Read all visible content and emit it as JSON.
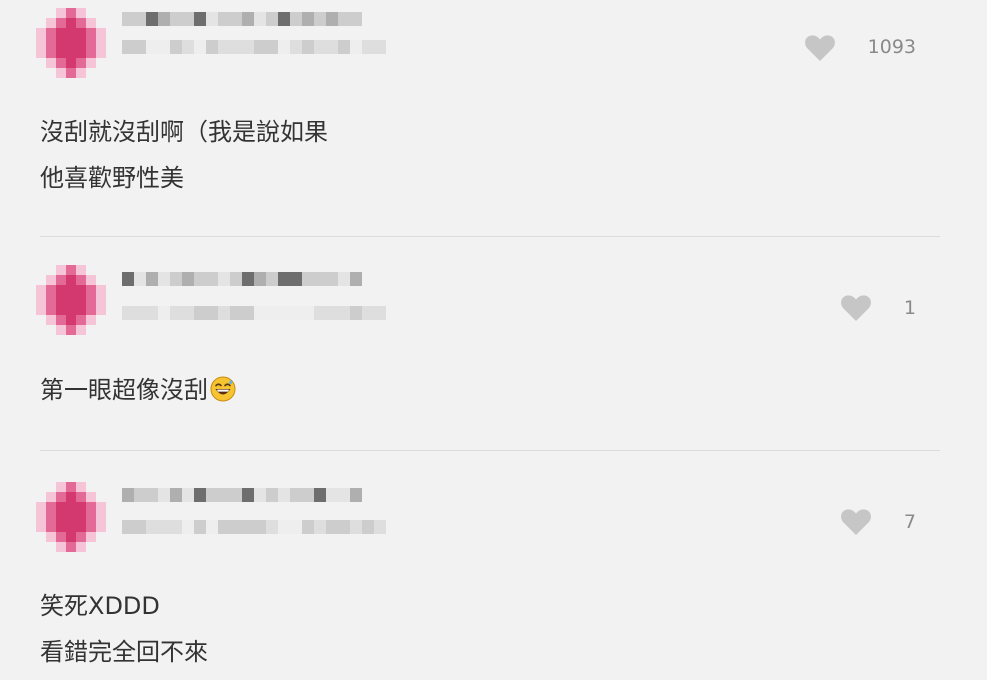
{
  "comments": [
    {
      "likes": "1093",
      "lines": [
        "沒刮就沒刮啊（我是說如果",
        "他喜歡野性美"
      ]
    },
    {
      "likes": "1",
      "lines": [
        "第一眼超像沒刮"
      ],
      "emoji": "grinning-face-with-sweat-icon"
    },
    {
      "likes": "7",
      "lines": [
        "笑死XDDD",
        "看錯完全回不來"
      ]
    }
  ],
  "colors": {
    "avatar_pink": "#e36a97",
    "avatar_dark": "#d3386f",
    "heart_gray": "#c6c6c6",
    "text": "#333333",
    "count": "#8a8a8a"
  }
}
